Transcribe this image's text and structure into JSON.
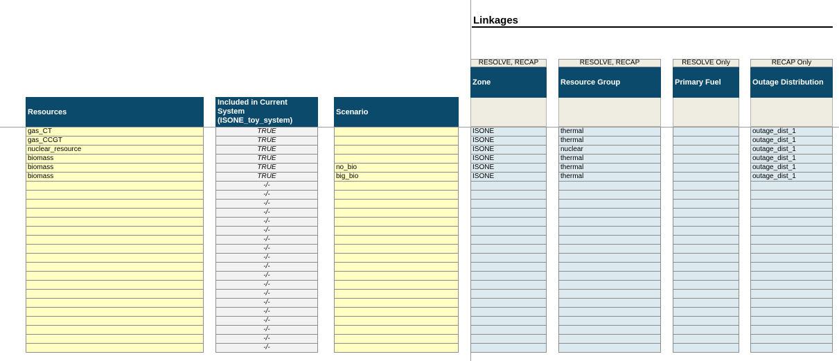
{
  "section_title": "Linkages",
  "columns": {
    "resources": {
      "header": "Resources"
    },
    "included": {
      "header_line1": "Included in Current",
      "header_line2": "System",
      "header_line3": "(ISONE_toy_system)"
    },
    "scenario": {
      "header": "Scenario"
    },
    "zone": {
      "tag": "RESOLVE, RECAP",
      "header": "Zone"
    },
    "resource_group": {
      "tag": "RESOLVE, RECAP",
      "header": "Resource Group"
    },
    "primary_fuel": {
      "tag": "RESOLVE Only",
      "header": "Primary Fuel"
    },
    "outage_distribution": {
      "tag": "RECAP Only",
      "header": "Outage Distribution"
    }
  },
  "rows": [
    {
      "resource": "gas_CT",
      "included": "TRUE",
      "scenario": "",
      "zone": "ISONE",
      "group": "thermal",
      "fuel": "",
      "outage": "outage_dist_1"
    },
    {
      "resource": "gas_CCGT",
      "included": "TRUE",
      "scenario": "",
      "zone": "ISONE",
      "group": "thermal",
      "fuel": "",
      "outage": "outage_dist_1"
    },
    {
      "resource": "nuclear_resource",
      "included": "TRUE",
      "scenario": "",
      "zone": "ISONE",
      "group": "nuclear",
      "fuel": "",
      "outage": "outage_dist_1"
    },
    {
      "resource": "biomass",
      "included": "TRUE",
      "scenario": "",
      "zone": "ISONE",
      "group": "thermal",
      "fuel": "",
      "outage": "outage_dist_1"
    },
    {
      "resource": "biomass",
      "included": "TRUE",
      "scenario": "no_bio",
      "zone": "ISONE",
      "group": "thermal",
      "fuel": "",
      "outage": "outage_dist_1"
    },
    {
      "resource": "biomass",
      "included": "TRUE",
      "scenario": "big_bio",
      "zone": "ISONE",
      "group": "thermal",
      "fuel": "",
      "outage": "outage_dist_1"
    }
  ],
  "empty_row_count": 19,
  "empty_included_value": "-/-"
}
